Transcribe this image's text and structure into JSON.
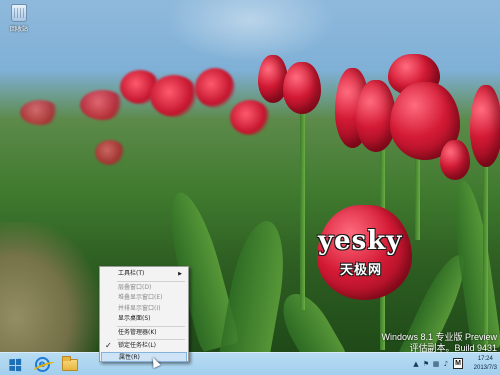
{
  "desktop": {
    "icons": [
      {
        "name": "recycle-bin",
        "label": "回收站"
      }
    ]
  },
  "watermark": {
    "latin": "yesky",
    "chinese": "天极网"
  },
  "build_info": {
    "line1": "Windows 8.1 专业版 Preview",
    "line2": "评估副本。Build 9431"
  },
  "context_menu": {
    "items": [
      {
        "label": "工具栏(T)",
        "has_submenu": true,
        "enabled": true
      },
      {
        "label": "层叠窗口(D)",
        "enabled": false
      },
      {
        "label": "堆叠显示窗口(E)",
        "enabled": false
      },
      {
        "label": "并排显示窗口(I)",
        "enabled": false
      },
      {
        "label": "显示桌面(S)",
        "enabled": true
      },
      {
        "label": "任务管理器(K)",
        "enabled": true
      },
      {
        "label": "锁定任务栏(L)",
        "enabled": true,
        "checked": true
      },
      {
        "label": "属性(R)",
        "enabled": true,
        "highlighted": true
      }
    ]
  },
  "taskbar": {
    "pinned": [
      {
        "name": "start-button"
      },
      {
        "name": "internet-explorer"
      },
      {
        "name": "file-explorer"
      }
    ],
    "tray": {
      "ime_label": "M",
      "time": "17:24",
      "date": "2013/7/3"
    }
  },
  "colors": {
    "taskbar": "#a2cfee",
    "tulip_red": "#d41a35",
    "menu_highlight": "#cfe3f7"
  }
}
